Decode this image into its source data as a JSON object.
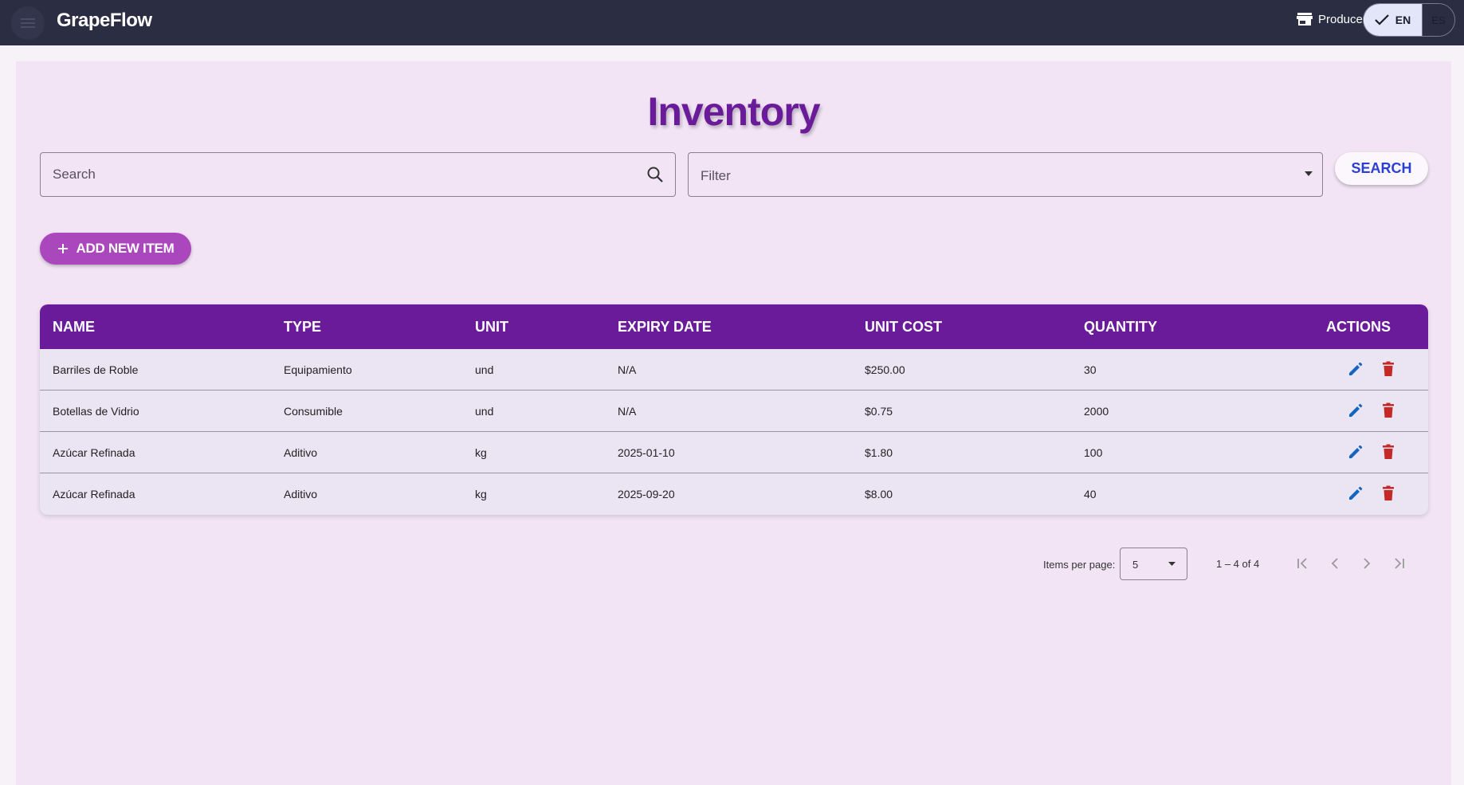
{
  "app": {
    "title": "GrapeFlow",
    "role": "Producer",
    "languages": {
      "active": "EN",
      "other": "ES"
    }
  },
  "page": {
    "title": "Inventory",
    "search_placeholder": "Search",
    "filter_label": "Filter",
    "search_button": "SEARCH",
    "add_button": "ADD NEW ITEM"
  },
  "table": {
    "headers": [
      "NAME",
      "TYPE",
      "UNIT",
      "EXPIRY DATE",
      "UNIT COST",
      "QUANTITY",
      "ACTIONS"
    ],
    "rows": [
      [
        "Barriles de Roble",
        "Equipamiento",
        "und",
        "N/A",
        "$250.00",
        "30"
      ],
      [
        "Botellas de Vidrio",
        "Consumible",
        "und",
        "N/A",
        "$0.75",
        "2000"
      ],
      [
        "Azúcar Refinada",
        "Aditivo",
        "kg",
        "2025-01-10",
        "$1.80",
        "100"
      ],
      [
        "Azúcar Refinada",
        "Aditivo",
        "kg",
        "2025-09-20",
        "$8.00",
        "40"
      ]
    ]
  },
  "paginator": {
    "label": "Items per page:",
    "page_size": "5",
    "range": "1 – 4 of 4"
  },
  "colors": {
    "topbar": "#2b2d42",
    "primary": "#6a1b9a",
    "accent": "#ab47bc",
    "edit": "#1565c0",
    "delete": "#c62828"
  },
  "icons": [
    "menu-icon",
    "store-icon",
    "check-icon",
    "search-icon",
    "dropdown-caret-icon",
    "plus-icon",
    "edit-icon",
    "delete-icon",
    "first-page-icon",
    "prev-page-icon",
    "next-page-icon",
    "last-page-icon"
  ]
}
